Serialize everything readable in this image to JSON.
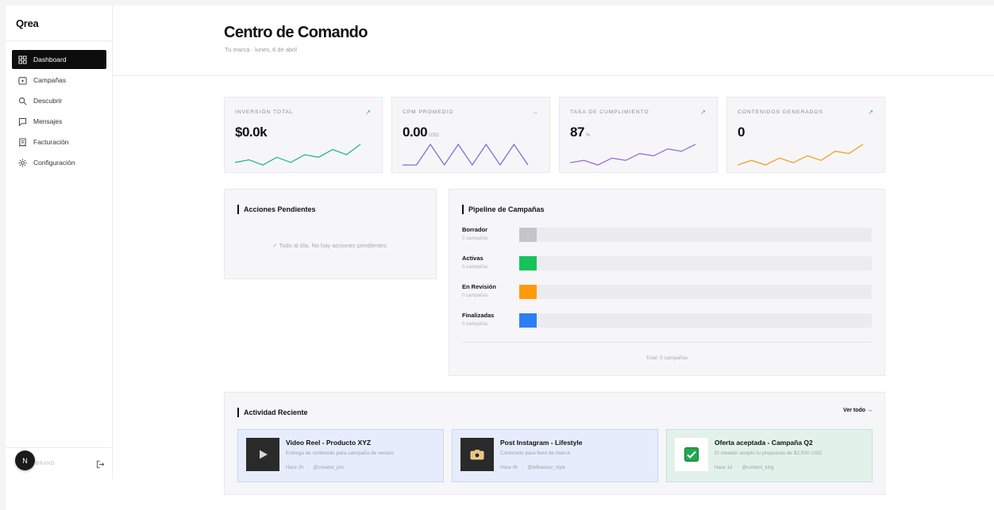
{
  "app": {
    "logo": "Qrea"
  },
  "sidebar": {
    "items": [
      {
        "label": "Dashboard",
        "icon": "grid-icon",
        "active": true
      },
      {
        "label": "Campañas",
        "icon": "megaphone-icon",
        "active": false
      },
      {
        "label": "Descubrir",
        "icon": "search-icon",
        "active": false
      },
      {
        "label": "Mensajes",
        "icon": "chat-icon",
        "active": false
      },
      {
        "label": "Facturación",
        "icon": "receipt-icon",
        "active": false
      },
      {
        "label": "Configuración",
        "icon": "gear-icon",
        "active": false
      }
    ],
    "user": {
      "initial": "N",
      "brand_label": "BRAND"
    }
  },
  "header": {
    "title": "Centro de Comando",
    "subtitle": "Tu marca · lunes, 6 de abril"
  },
  "kpis": [
    {
      "label": "INVERSIÓN TOTAL",
      "value": "$0.0k",
      "unit": "",
      "trend": "↗",
      "trend_color": "#1fb56d",
      "spark_color": "#25b88a",
      "spark": [
        3,
        4,
        2,
        5,
        3,
        6,
        5,
        8,
        6,
        10
      ]
    },
    {
      "label": "CPM PROMEDIO",
      "value": "0.00",
      "unit": "USD",
      "trend": "→",
      "trend_color": "#9a9aa2",
      "spark_color": "#7b6fd9",
      "spark": [
        0,
        0,
        10,
        0,
        10,
        0,
        10,
        0,
        10,
        0
      ]
    },
    {
      "label": "TASA DE CUMPLIMIENTO",
      "value": "87",
      "unit": "%",
      "trend": "↗",
      "trend_color": "#1fb56d",
      "spark_color": "#9b6fe0",
      "spark": [
        2,
        3,
        1,
        4,
        3,
        6,
        5,
        8,
        7,
        10
      ]
    },
    {
      "label": "CONTENIDOS GENERADOS",
      "value": "0",
      "unit": "",
      "trend": "↗",
      "trend_color": "#1fb56d",
      "spark_color": "#f0a020",
      "spark": [
        1,
        3,
        1,
        4,
        2,
        5,
        3,
        7,
        6,
        10
      ]
    }
  ],
  "pending": {
    "title": "Acciones Pendientes",
    "empty_message": "✓ Todo al día. No hay acciones pendientes."
  },
  "pipeline": {
    "title": "Pipeline de Campañas",
    "stages": [
      {
        "name": "Borrador",
        "count_label": "0 campañas",
        "color": "#c4c4ca"
      },
      {
        "name": "Activas",
        "count_label": "0 campañas",
        "color": "#15c35a"
      },
      {
        "name": "En Revisión",
        "count_label": "0 campañas",
        "color": "#ff9a0a"
      },
      {
        "name": "Finalizadas",
        "count_label": "0 campañas",
        "color": "#2d7df5"
      }
    ],
    "total_label": "Total: 0 campañas"
  },
  "activity": {
    "title": "Actividad Reciente",
    "see_all": "Ver todo →",
    "items": [
      {
        "title": "Video Reel - Producto XYZ",
        "description": "Entrega de contenido para campaña de verano",
        "time": "Hace 2h",
        "separator": "·",
        "handle": "@creador_pro",
        "icon": "play-icon",
        "bg": "#e6ecfb",
        "border": "#c9d6f5",
        "thumb_bg": "#2a2a2a"
      },
      {
        "title": "Post Instagram - Lifestyle",
        "description": "Contenido para feed de marca",
        "time": "Hace 4h",
        "separator": "·",
        "handle": "@influencer_style",
        "icon": "camera-icon",
        "bg": "#e6ecfb",
        "border": "#c9d6f5",
        "thumb_bg": "#2a2a2a"
      },
      {
        "title": "Oferta aceptada - Campaña Q2",
        "description": "El creador aceptó tu propuesta de $2,500 USD",
        "time": "Hace 1d",
        "separator": "·",
        "handle": "@content_king",
        "icon": "check-icon",
        "bg": "#e2f2ea",
        "border": "#c3e4d2",
        "thumb_bg": "#ffffff"
      }
    ]
  }
}
